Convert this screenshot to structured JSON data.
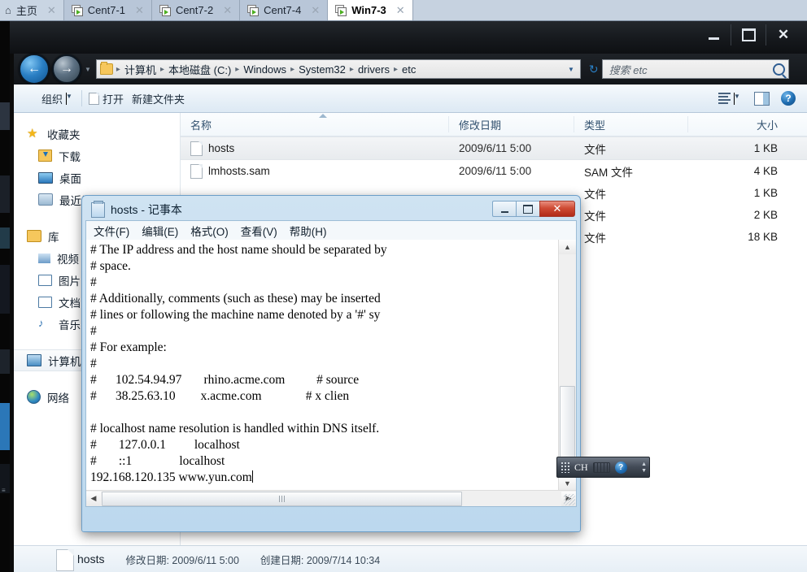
{
  "vm_tabs": [
    {
      "label": "主页",
      "icon": "home-icon",
      "active": false,
      "home": true
    },
    {
      "label": "Cent7-1",
      "icon": "vm-icon",
      "active": false
    },
    {
      "label": "Cent7-2",
      "icon": "vm-icon",
      "active": false
    },
    {
      "label": "Cent7-4",
      "icon": "vm-icon",
      "active": false
    },
    {
      "label": "Win7-3",
      "icon": "vm-icon",
      "active": true
    }
  ],
  "tab_close_glyph": "✕",
  "window": {
    "minimize": "—",
    "maximize": "❐",
    "close": "✕"
  },
  "address": {
    "back_glyph": "←",
    "forward_glyph": "→",
    "breadcrumbs": [
      "计算机",
      "本地磁盘 (C:)",
      "Windows",
      "System32",
      "drivers",
      "etc"
    ],
    "separator": "▸",
    "dropdown_glyph": "▼",
    "refresh_glyph": "↻"
  },
  "search": {
    "placeholder": "搜索 etc",
    "icon": "search-icon"
  },
  "command_bar": {
    "organize": "组织",
    "organize_caret": "▼",
    "open": "打开",
    "new_folder": "新建文件夹",
    "view_caret": "▼"
  },
  "sidebar": {
    "groups": [
      {
        "header": {
          "label": "收藏夹",
          "icon": "star-icon"
        },
        "items": [
          {
            "label": "下载",
            "icon": "downloads-icon"
          },
          {
            "label": "桌面",
            "icon": "desktop-icon"
          },
          {
            "label": "最近访问的位置",
            "icon": "recent-places-icon"
          }
        ]
      },
      {
        "header": {
          "label": "库",
          "icon": "library-icon"
        },
        "items": [
          {
            "label": "视频",
            "icon": "videos-icon"
          },
          {
            "label": "图片",
            "icon": "pictures-icon"
          },
          {
            "label": "文档",
            "icon": "documents-icon"
          },
          {
            "label": "音乐",
            "icon": "music-icon"
          }
        ]
      },
      {
        "header": {
          "label": "计算机",
          "icon": "computer-icon",
          "selected": true
        },
        "items": []
      },
      {
        "header": {
          "label": "网络",
          "icon": "network-icon"
        },
        "items": []
      }
    ]
  },
  "file_list": {
    "columns": [
      "名称",
      "修改日期",
      "类型",
      "大小"
    ],
    "sorted_column": "名称",
    "rows": [
      {
        "name": "hosts",
        "date": "2009/6/11 5:00",
        "type": "文件",
        "size": "1 KB",
        "selected": true
      },
      {
        "name": "lmhosts.sam",
        "date": "2009/6/11 5:00",
        "type": "SAM 文件",
        "size": "4 KB",
        "selected": false
      },
      {
        "name": "",
        "date": "",
        "type": "文件",
        "size": "1 KB",
        "selected": false
      },
      {
        "name": "",
        "date": "",
        "type": "文件",
        "size": "2 KB",
        "selected": false
      },
      {
        "name": "",
        "date": "",
        "type": "文件",
        "size": "18 KB",
        "selected": false
      }
    ]
  },
  "status_bar": {
    "file_name": "hosts",
    "modified": "修改日期: 2009/6/11 5:00",
    "created": "创建日期: 2009/7/14 10:34"
  },
  "notepad": {
    "title": "hosts - 记事本",
    "menu": [
      "文件(F)",
      "编辑(E)",
      "格式(O)",
      "查看(V)",
      "帮助(H)"
    ],
    "controls": {
      "minimize": "",
      "maximize": "",
      "close": "✕"
    },
    "content": "# The IP address and the host name should be separated by\n# space.\n#\n# Additionally, comments (such as these) may be inserted\n# lines or following the machine name denoted by a '#' sy\n#\n# For example:\n#\n#      102.54.94.97       rhino.acme.com          # source\n#      38.25.63.10        x.acme.com              # x clien\n\n# localhost name resolution is handled within DNS itself.\n#       127.0.0.1         localhost\n#       ::1               localhost\n192.168.120.135 www.yun.com",
    "scroll_up_glyph": "▲",
    "scroll_down_glyph": "▼",
    "scroll_left_glyph": "◀",
    "scroll_right_glyph": "▶"
  },
  "ime": {
    "language": "CH",
    "keyboard_icon": "keyboard-icon",
    "help_icon": "help-icon",
    "up_glyph": "▲",
    "down_glyph": "▼"
  },
  "colors": {
    "accent": "#2a7fc4",
    "close_red": "#cf4c35",
    "tab_active": "#ffffff",
    "tab_bg": "#b8c6d8"
  }
}
